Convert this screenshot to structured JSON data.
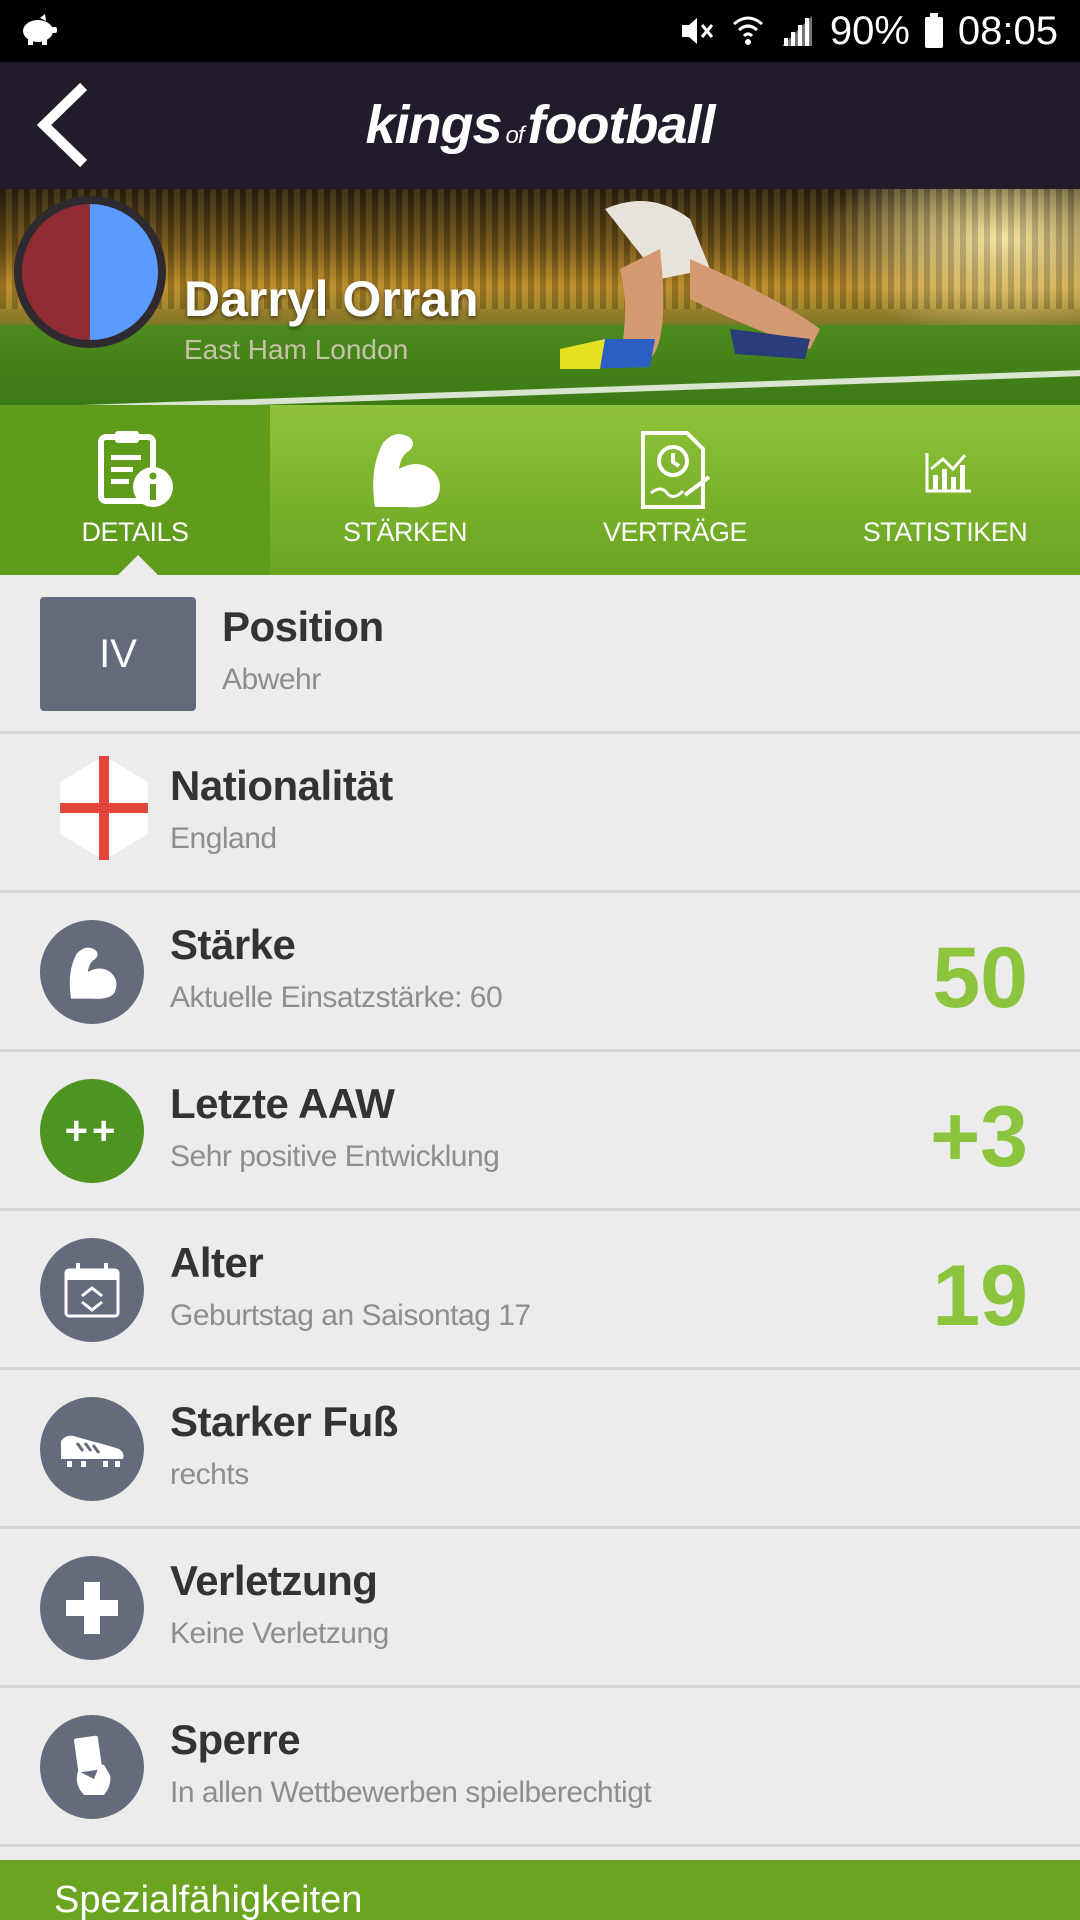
{
  "status_bar": {
    "battery": "90%",
    "time": "08:05"
  },
  "app_bar": {
    "brand_main_1": "kings",
    "brand_of": "of",
    "brand_main_2": "football"
  },
  "player": {
    "name": "Darryl Orran",
    "club": "East Ham London"
  },
  "tabs": [
    {
      "label": "DETAILS",
      "active": true
    },
    {
      "label": "STÄRKEN",
      "active": false
    },
    {
      "label": "VERTRÄGE",
      "active": false
    },
    {
      "label": "STATISTIKEN",
      "active": false
    }
  ],
  "details": {
    "position": {
      "badge": "IV",
      "title": "Position",
      "sub": "Abwehr"
    },
    "nationality": {
      "title": "Nationalität",
      "sub": "England"
    },
    "strength": {
      "title": "Stärke",
      "sub": "Aktuelle Einsatzstärke: 60",
      "value": "50"
    },
    "last_aaw": {
      "badge": "++",
      "title": "Letzte AAW",
      "sub": "Sehr positive Entwicklung",
      "value": "+3"
    },
    "age": {
      "title": "Alter",
      "sub": "Geburtstag an Saisontag 17",
      "value": "19"
    },
    "strong_foot": {
      "title": "Starker Fuß",
      "sub": "rechts"
    },
    "injury": {
      "title": "Verletzung",
      "sub": "Keine Verletzung"
    },
    "suspension": {
      "title": "Sperre",
      "sub": "In allen Wettbewerben spielberechtigt"
    }
  },
  "footer": {
    "section_title": "Spezialfähigkeiten"
  },
  "colors": {
    "app_bar": "#221b2b",
    "accent_green": "#8cc53d",
    "tab_green": "#6aa420",
    "icon_circle": "#646b7d"
  }
}
